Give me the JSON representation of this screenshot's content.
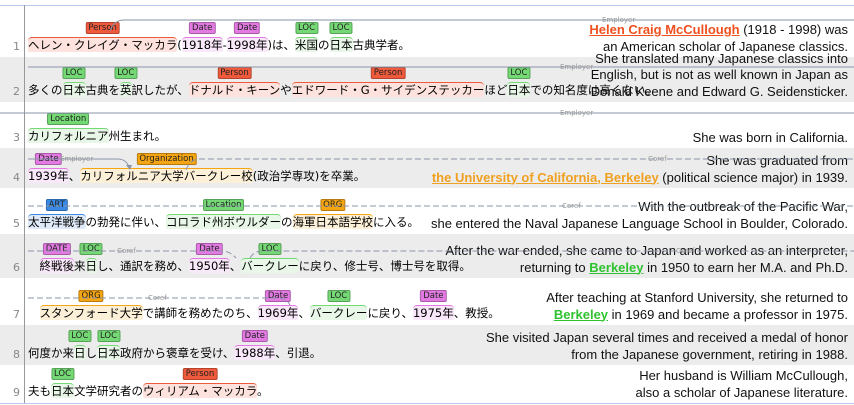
{
  "colors": {
    "Person": {
      "label": "#ef5a3c",
      "bg": "#fde2dd"
    },
    "Date": {
      "label": "#e27ae2",
      "bg": "#f9e8f9"
    },
    "DATE": {
      "label": "#e27ae2",
      "bg": "#f9e8f9"
    },
    "LOC": {
      "label": "#74d874",
      "bg": "#e8f7e8"
    },
    "Location": {
      "label": "#74d874",
      "bg": "#e8f7e8"
    },
    "Organization": {
      "label": "#f5a512",
      "bg": "#fdf0d8"
    },
    "ORG": {
      "label": "#f5a512",
      "bg": "#fdf0d8"
    },
    "ART": {
      "label": "#3a8ae6",
      "bg": "#dfeaf8"
    }
  },
  "relations": {
    "employer": "Employer",
    "coref": "Coref"
  },
  "rows": [
    {
      "num": "1",
      "segments": [
        {
          "text": "ヘレン・クレイグ・マッカラ",
          "type": "Person"
        },
        {
          "text": "("
        },
        {
          "text": "1918年",
          "type": "Date"
        },
        {
          "text": "-"
        },
        {
          "text": "1998年",
          "type": "Date"
        },
        {
          "text": ")は、"
        },
        {
          "text": "米国",
          "type": "LOC"
        },
        {
          "text": "の"
        },
        {
          "text": "日本",
          "type": "LOC"
        },
        {
          "text": "古典学者。"
        }
      ],
      "en": [
        [
          {
            "text": "Helen Craig McCullough",
            "link": "#f0501e"
          },
          {
            "text": " (1918 - 1998) was"
          }
        ],
        [
          {
            "text": "an American scholar of Japanese classics."
          }
        ]
      ]
    },
    {
      "num": "2",
      "segments": [
        {
          "text": "多くの"
        },
        {
          "text": "日本",
          "type": "LOC"
        },
        {
          "text": "古典を"
        },
        {
          "text": "英",
          "type": "LOC"
        },
        {
          "text": "訳したが、"
        },
        {
          "text": "ドナルド・キーン",
          "type": "Person"
        },
        {
          "text": "や"
        },
        {
          "text": "エドワード・G・サイデンステッカー",
          "type": "Person"
        },
        {
          "text": "ほど"
        },
        {
          "text": "日本",
          "type": "LOC"
        },
        {
          "text": "での知名度は高くない。"
        }
      ],
      "en": [
        [
          {
            "text": "She translated many Japanese classics into"
          }
        ],
        [
          {
            "text": "English, but is not as well known in Japan as"
          }
        ],
        [
          {
            "text": "Donald Keene and Edward G. Seidensticker."
          }
        ]
      ]
    },
    {
      "num": "3",
      "segments": [
        {
          "text": "カリフォルニア",
          "type": "Location"
        },
        {
          "text": "州生まれ。"
        }
      ],
      "en": [
        [
          {
            "text": "She was born in California."
          }
        ]
      ]
    },
    {
      "num": "4",
      "segments": [
        {
          "text": "1939年",
          "type": "Date"
        },
        {
          "text": "、"
        },
        {
          "text": "カリフォルニア大学バークレー校",
          "type": "Organization"
        },
        {
          "text": "(政治学専攻)を卒業。"
        }
      ],
      "en": [
        [
          {
            "text": "She was graduated from"
          }
        ],
        [
          {
            "text": "the University of California, Berkeley",
            "link": "#f0a020"
          },
          {
            "text": " (political science major) in 1939."
          }
        ]
      ]
    },
    {
      "num": "5",
      "segments": [
        {
          "text": "太平洋戦争",
          "type": "ART"
        },
        {
          "text": "の勃発に伴い、"
        },
        {
          "text": "コロラド州ボウルダー",
          "type": "Location"
        },
        {
          "text": "の"
        },
        {
          "text": "海軍日本語学校",
          "type": "ORG"
        },
        {
          "text": "に入る。"
        }
      ],
      "en": [
        [
          {
            "text": "With the outbreak of the Pacific War,"
          }
        ],
        [
          {
            "text": "she entered the Naval Japanese Language School in Boulder, Colorado."
          }
        ]
      ]
    },
    {
      "num": "6",
      "segments": [
        {
          "text": "　"
        },
        {
          "text": "終戦後",
          "type": "DATE"
        },
        {
          "text": "来"
        },
        {
          "text": "日",
          "type": "LOC"
        },
        {
          "text": "し、通訳を務め、"
        },
        {
          "text": "1950年",
          "type": "Date"
        },
        {
          "text": "、"
        },
        {
          "text": "バークレー",
          "type": "LOC"
        },
        {
          "text": "に戻り、修士号、博士号を取得。"
        }
      ],
      "en": [
        [
          {
            "text": "After the war ended, she came to Japan and worked as an interpreter,"
          }
        ],
        [
          {
            "text": "returning to "
          },
          {
            "text": "Berkeley",
            "link": "#2fc22f"
          },
          {
            "text": " in 1950 to earn her M.A. and Ph.D."
          }
        ]
      ]
    },
    {
      "num": "7",
      "segments": [
        {
          "text": "　"
        },
        {
          "text": "スタンフォード大学",
          "type": "ORG"
        },
        {
          "text": "で講師を務めたのち、"
        },
        {
          "text": "1969年",
          "type": "Date"
        },
        {
          "text": "、"
        },
        {
          "text": "バークレー",
          "type": "LOC"
        },
        {
          "text": "に戻り、"
        },
        {
          "text": "1975年",
          "type": "Date"
        },
        {
          "text": "、教授。"
        }
      ],
      "en": [
        [
          {
            "text": "After teaching at Stanford University, she returned to"
          }
        ],
        [
          {
            "text": "Berkeley",
            "link": "#2fc22f"
          },
          {
            "text": " in 1969 and became a professor in 1975."
          }
        ]
      ]
    },
    {
      "num": "8",
      "segments": [
        {
          "text": "何度か来"
        },
        {
          "text": "日",
          "type": "LOC"
        },
        {
          "text": "し"
        },
        {
          "text": "日本",
          "type": "LOC"
        },
        {
          "text": "政府から褒章を受け、"
        },
        {
          "text": "1988年",
          "type": "Date"
        },
        {
          "text": "、引退。"
        }
      ],
      "en": [
        [
          {
            "text": "She visited Japan several times and received a medal of honor"
          }
        ],
        [
          {
            "text": "from the Japanese government, retiring in 1988."
          }
        ]
      ]
    },
    {
      "num": "9",
      "segments": [
        {
          "text": "夫も"
        },
        {
          "text": "日本",
          "type": "LOC"
        },
        {
          "text": "文学研究者の"
        },
        {
          "text": "ウィリアム・マッカラ",
          "type": "Person"
        },
        {
          "text": "。"
        }
      ],
      "en": [
        [
          {
            "text": "Her husband is William McCullough,"
          }
        ],
        [
          {
            "text": "also a scholar of Japanese literature."
          }
        ]
      ]
    }
  ]
}
